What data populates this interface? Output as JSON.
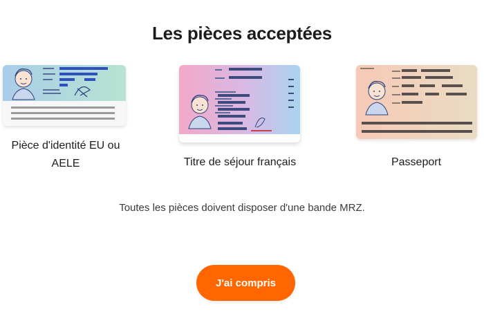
{
  "page": {
    "title": "Les pièces acceptées",
    "note": "Toutes les pièces doivent disposer d'une bande MRZ.",
    "confirm_label": "J'ai compris"
  },
  "documents": [
    {
      "label": "Pièce d'identité EU ou AELE",
      "icon": "eu-id-card-icon"
    },
    {
      "label": "Titre de séjour français",
      "icon": "residence-permit-icon"
    },
    {
      "label": "Passeport",
      "icon": "passport-icon"
    }
  ],
  "colors": {
    "accent": "#ff6600",
    "id_card_gradient": [
      "#a9cde8",
      "#b9e3d2"
    ],
    "permit_gradient": [
      "#f2a9c8",
      "#a9d4ef"
    ],
    "passport_gradient": [
      "#f6c9b6",
      "#eadcc4"
    ]
  }
}
